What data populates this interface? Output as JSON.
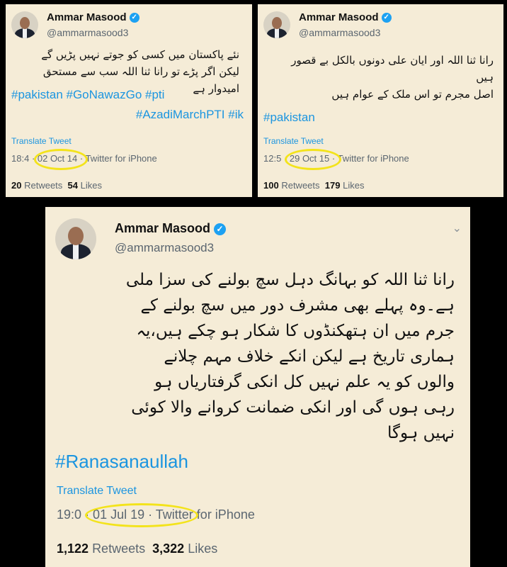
{
  "tweet1": {
    "name": "Ammar Masood",
    "handle": "@ammarmasood3",
    "text_line1": "نئے پاکستان میں کسی کو جوتے نہیں پڑیں گے",
    "text_line2": "لیکن اگر پڑے تو رانا ثنا اللہ سب سے مستحق",
    "text_line3": "امیدوار ہے",
    "hashtags_line1": "#pakistan #GoNawazGo #pti",
    "hashtags_line2": "#AzadiMarchPTI #ik",
    "translate": "Translate Tweet",
    "time": "18:4",
    "date": "· 02 Oct 14 ·",
    "source": "Twitter for iPhone",
    "retweets_count": "20",
    "retweets_label": "Retweets",
    "likes_count": "54",
    "likes_label": "Likes"
  },
  "tweet2": {
    "name": "Ammar Masood",
    "handle": "@ammarmasood3",
    "text_line1": "رانا ثنا اللہ اور ایان علی دونوں بالکل بے قصور",
    "text_line2": "ہیں",
    "text_line3": "اصل مجرم تو اس ملک کے عوام ہیں",
    "hashtags_line1": "#pakistan",
    "translate": "Translate Tweet",
    "time": "12:5",
    "date": "· 29 Oct 15 ·",
    "source": "Twitter for iPhone",
    "retweets_count": "100",
    "retweets_label": "Retweets",
    "likes_count": "179",
    "likes_label": "Likes"
  },
  "tweet3": {
    "name": "Ammar Masood",
    "handle": "@ammarmasood3",
    "text_line1": "رانا ثنا اللہ کو بہانگ دہل سچ بولنے کی سزا ملی",
    "text_line2": "ہے۔وہ پہلے بھی مشرف دور میں سچ بولنے کے",
    "text_line3": "جرم میں ان ہتھکنڈوں کا شکار ہو چکے ہیں،یہ",
    "text_line4": "ہماری تاریخ ہے لیکن انکے خلاف مہم چلانے",
    "text_line5": "والوں کو یہ علم نہیں کل انکی گرفتاریاں ہو",
    "text_line6": "رہی ہوں گی اور انکی ضمانت کروانے والا کوئی",
    "text_line7": "نہیں ہوگا",
    "hashtags_line1": "#Ranasanaullah",
    "translate": "Translate Tweet",
    "time": "19:0",
    "date": "· 01 Jul 19 ·",
    "source": "Twitter for iPhone",
    "retweets_count": "1,122",
    "retweets_label": "Retweets",
    "likes_count": "3,322",
    "likes_label": "Likes"
  },
  "icons": {
    "verified": "verified-badge-icon",
    "chevron": "chevron-down-icon"
  },
  "colors": {
    "link": "#1b95e0",
    "highlight": "#f3e31b",
    "card_bg": "#f5ecd7"
  }
}
